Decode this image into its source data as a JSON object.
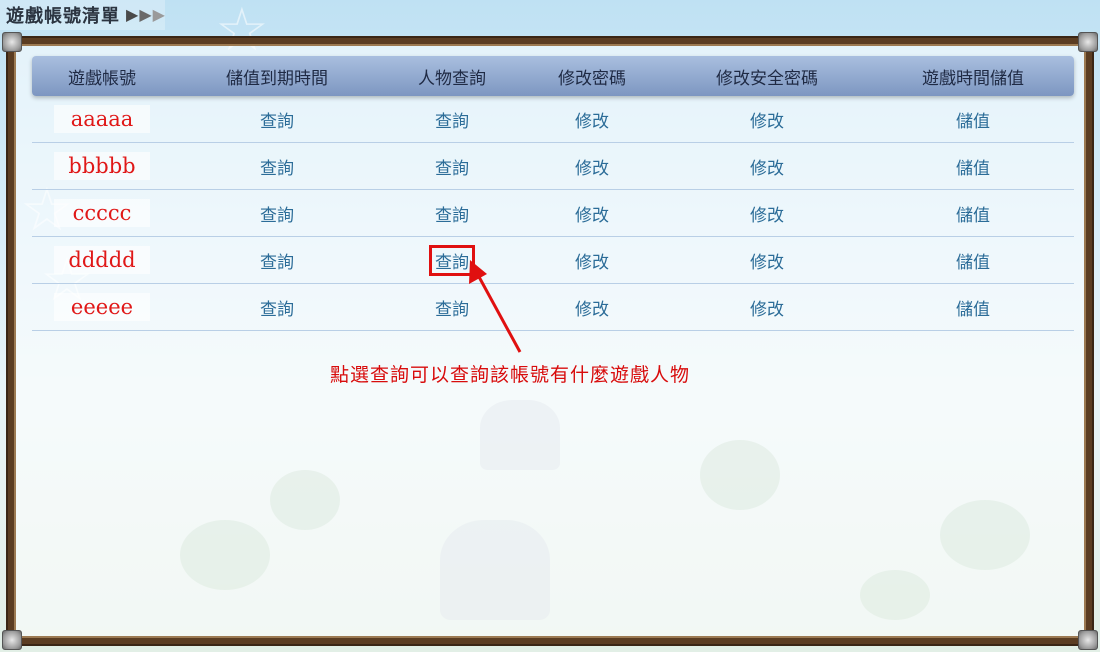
{
  "header": {
    "title": "遊戲帳號清單",
    "arrow_colors": [
      "#4a4a4a",
      "#6a6a6a",
      "#9a9a9a"
    ]
  },
  "table": {
    "columns": [
      "遊戲帳號",
      "儲值到期時間",
      "人物查詢",
      "修改密碼",
      "修改安全密碼",
      "遊戲時間儲值"
    ],
    "rows": [
      {
        "account": "aaaaa",
        "expiry": "查詢",
        "character": "查詢",
        "password": "修改",
        "secure_password": "修改",
        "topup": "儲值"
      },
      {
        "account": "bbbbb",
        "expiry": "查詢",
        "character": "查詢",
        "password": "修改",
        "secure_password": "修改",
        "topup": "儲值"
      },
      {
        "account": "ccccc",
        "expiry": "查詢",
        "character": "查詢",
        "password": "修改",
        "secure_password": "修改",
        "topup": "儲值"
      },
      {
        "account": "ddddd",
        "expiry": "查詢",
        "character": "查詢",
        "password": "修改",
        "secure_password": "修改",
        "topup": "儲值"
      },
      {
        "account": "eeeee",
        "expiry": "查詢",
        "character": "查詢",
        "password": "修改",
        "secure_password": "修改",
        "topup": "儲值"
      }
    ]
  },
  "annotation": {
    "text": "點選查詢可以查詢該帳號有什麼遊戲人物",
    "color": "#e01010"
  },
  "colors": {
    "account_text": "#e01818",
    "link_text": "#2b6c98",
    "frame": "#5b3d22"
  }
}
